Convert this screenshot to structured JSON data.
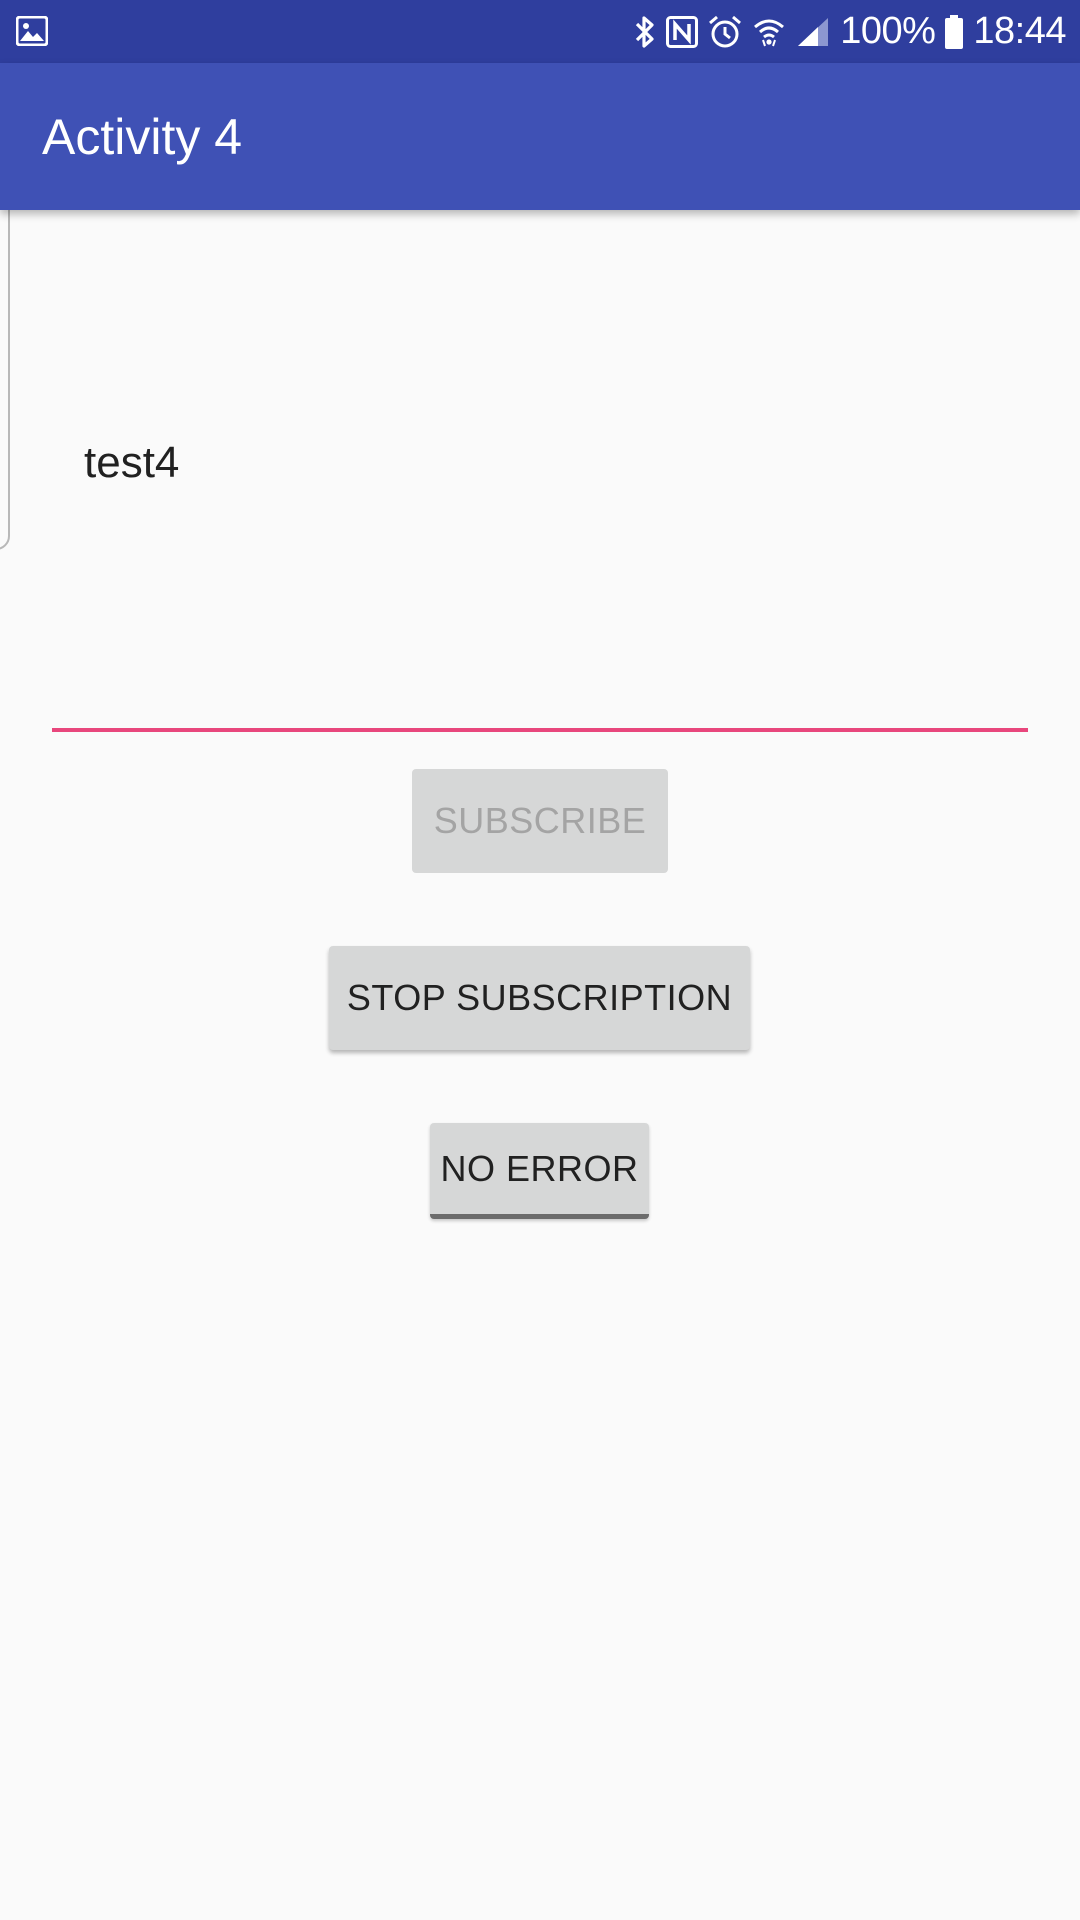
{
  "status_bar": {
    "left_icons": [
      "gallery-icon"
    ],
    "right_icons": [
      "bluetooth-icon",
      "nfc-icon",
      "alarm-icon",
      "wifi-icon",
      "signal-icon"
    ],
    "battery_percent": "100%",
    "battery_level": 1.0,
    "time": "18:44"
  },
  "app_bar": {
    "title": "Activity 4",
    "color": "#3f51b5"
  },
  "input": {
    "value": "test4",
    "underline_color": "#e8467c"
  },
  "buttons": {
    "subscribe": "SUBSCRIBE",
    "stop_subscription": "STOP SUBSCRIPTION",
    "no_error": "NO ERROR"
  }
}
